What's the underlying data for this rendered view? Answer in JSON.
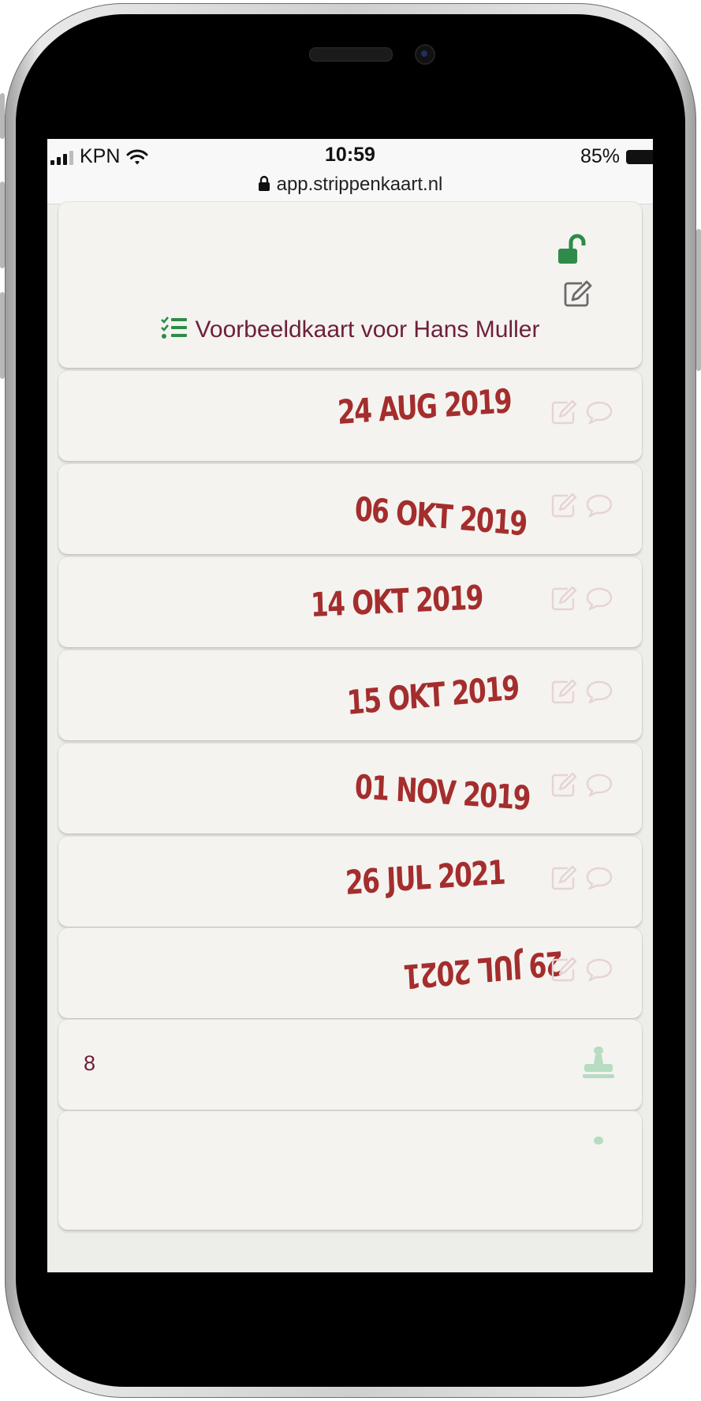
{
  "statusbar": {
    "carrier": "KPN",
    "time": "10:59",
    "battery": "85%",
    "url": "app.strippenkaart.nl"
  },
  "card": {
    "title": "Voorbeeldkaart voor Hans Muller"
  },
  "stamps": [
    {
      "date": "24 AUG 2019"
    },
    {
      "date": "06 OKT 2019"
    },
    {
      "date": "14 OKT 2019"
    },
    {
      "date": "15 OKT 2019"
    },
    {
      "date": "01 NOV 2019"
    },
    {
      "date": "26 JUL 2021"
    },
    {
      "date": "29 JUL 2021"
    }
  ],
  "next_strip": {
    "number": "8"
  },
  "colors": {
    "accent_green": "#2e8b4a",
    "stamp_red": "#a42d2d",
    "title_text": "#6d1f3c",
    "card_bg": "#f4f3ef"
  },
  "icons": {
    "lock": "unlock-icon",
    "edit": "edit-icon",
    "comment": "comment-icon",
    "list": "checklist-icon",
    "stamp": "stamp-icon"
  }
}
